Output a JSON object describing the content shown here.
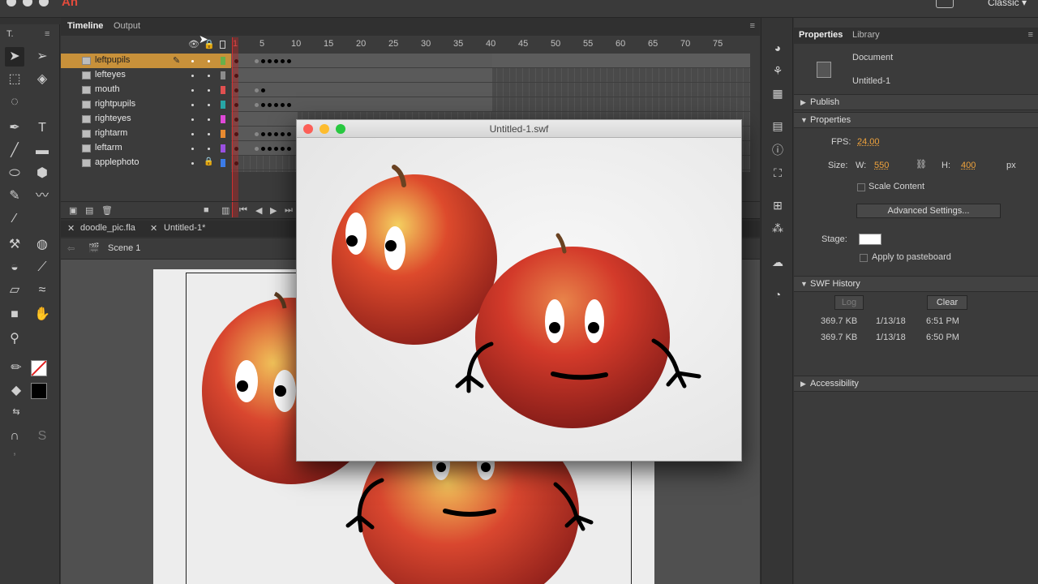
{
  "top_bar": {
    "app_logo": "An",
    "workspace": "Classic ▾"
  },
  "timeline": {
    "tabs": [
      "Timeline",
      "Output"
    ],
    "ruler": [
      "1",
      "5",
      "10",
      "15",
      "20",
      "25",
      "30",
      "35",
      "40",
      "45",
      "50",
      "55",
      "60",
      "65",
      "70",
      "75"
    ],
    "layers": [
      {
        "name": "leftpupils",
        "color": "#69b04a"
      },
      {
        "name": "lefteyes",
        "color": "#8c8c8c"
      },
      {
        "name": "mouth",
        "color": "#e05050"
      },
      {
        "name": "rightpupils",
        "color": "#27a6a6"
      },
      {
        "name": "righteyes",
        "color": "#e048d8"
      },
      {
        "name": "rightarm",
        "color": "#e88a30"
      },
      {
        "name": "leftarm",
        "color": "#9a50e0"
      },
      {
        "name": "applephoto",
        "color": "#3b7be8"
      }
    ],
    "playhead_frame": "1"
  },
  "documents": {
    "tabs": [
      "doodle_pic.fla",
      "Untitled-1*"
    ],
    "scene": "Scene 1"
  },
  "swf_window": {
    "title": "Untitled-1.swf"
  },
  "properties_panel": {
    "tabs": [
      "Properties",
      "Library"
    ],
    "document_label": "Document",
    "document_name": "Untitled-1",
    "publish_section": "Publish",
    "properties_section": "Properties",
    "fps_label": "FPS:",
    "fps_value": "24.00",
    "size_label": "Size:",
    "w_label": "W:",
    "w_value": "550",
    "h_label": "H:",
    "h_value": "400",
    "unit": "px",
    "scale_content": "Scale Content",
    "advanced_settings": "Advanced Settings...",
    "stage_label": "Stage:",
    "stage_color": "#ffffff",
    "apply_pasteboard": "Apply to pasteboard",
    "swf_history_section": "SWF History",
    "log_button": "Log",
    "clear_button": "Clear",
    "history": [
      {
        "size": "369.7 KB",
        "date": "1/13/18",
        "time": "6:51 PM"
      },
      {
        "size": "369.7 KB",
        "date": "1/13/18",
        "time": "6:50 PM"
      }
    ],
    "accessibility_section": "Accessibility"
  }
}
